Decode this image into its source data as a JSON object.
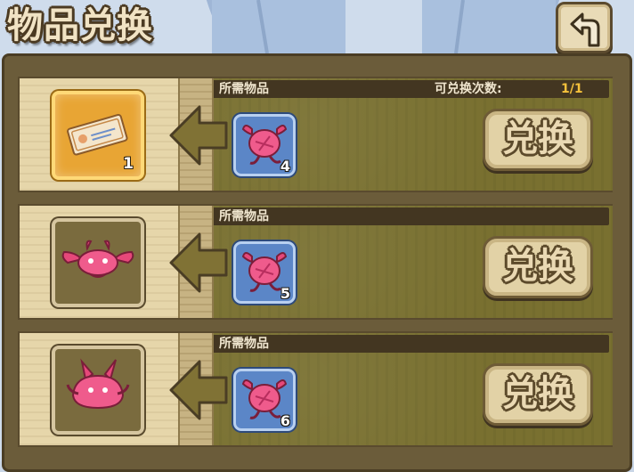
{
  "header": {
    "title": "物品兑换",
    "back_icon": "back-arrow-icon"
  },
  "colors": {
    "panel": "#6b5c3a",
    "header_bar": "#433621",
    "limit_value": "#f6c23c",
    "required_frame": "#5b86c7"
  },
  "exchange_rows": [
    {
      "reward": {
        "icon": "ticket-icon",
        "count": "1",
        "rarity": "gold"
      },
      "required_label": "所需物品",
      "limit_label": "可兑换次数:",
      "limit_value": "1/1",
      "required": {
        "icon": "pink-creature-icon",
        "count": "4"
      },
      "button_label": "兑换"
    },
    {
      "reward": {
        "icon": "pink-bat-creature-icon",
        "count": "",
        "rarity": "plain"
      },
      "required_label": "所需物品",
      "required": {
        "icon": "pink-creature-icon",
        "count": "5"
      },
      "button_label": "兑换"
    },
    {
      "reward": {
        "icon": "pink-horned-creature-icon",
        "count": "",
        "rarity": "plain"
      },
      "required_label": "所需物品",
      "required": {
        "icon": "pink-creature-icon",
        "count": "6"
      },
      "button_label": "兑换"
    }
  ]
}
